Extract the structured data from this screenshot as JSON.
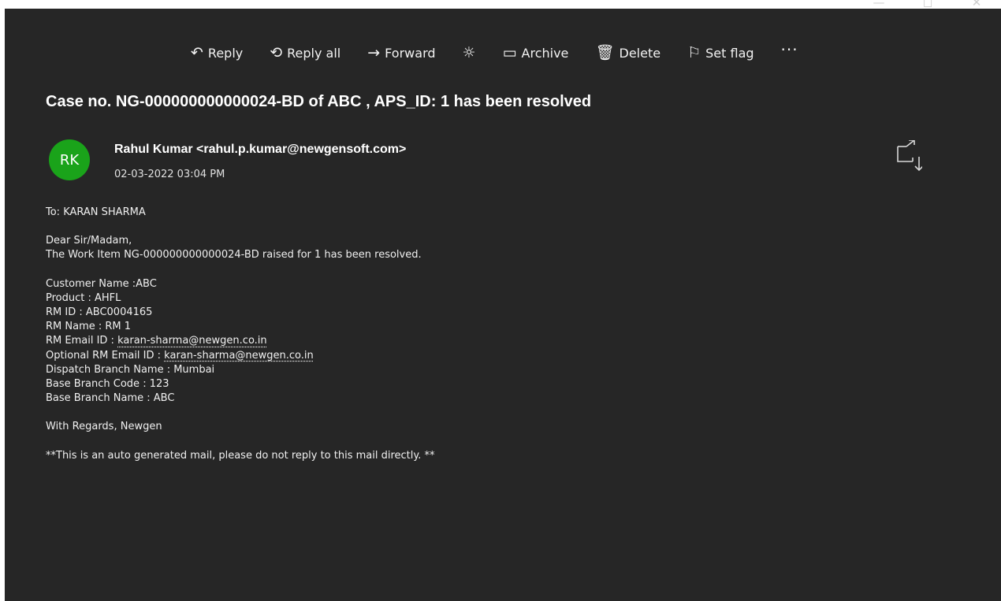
{
  "window": {
    "controls": {
      "minimize": "—",
      "restore": "◻",
      "close": "✕"
    }
  },
  "toolbar": {
    "reply": {
      "icon": "reply-icon",
      "glyph": "↶",
      "label": "Reply"
    },
    "reply_all": {
      "icon": "reply-all-icon",
      "glyph": "⟲",
      "label": "Reply all"
    },
    "forward": {
      "icon": "forward-icon",
      "glyph": "→",
      "label": "Forward"
    },
    "theme": {
      "icon": "sun-icon",
      "glyph": "☼"
    },
    "archive": {
      "icon": "archive-icon",
      "glyph": "▭",
      "label": "Archive"
    },
    "delete": {
      "icon": "trash-icon",
      "glyph": "🗑",
      "label": "Delete"
    },
    "set_flag": {
      "icon": "flag-icon",
      "glyph": "⚐",
      "label": "Set flag"
    },
    "more": {
      "icon": "more-icon",
      "glyph": "···"
    }
  },
  "message": {
    "subject": "Case no. NG-000000000000024-BD of  ABC , APS_ID:  1 has been resolved",
    "avatar_initials": "RK",
    "avatar_color": "#1aa31a",
    "sender": "Rahul  Kumar <rahul.p.kumar@newgensoft.com>",
    "date": "02-03-2022 03:04 PM",
    "to": "To: KARAN  SHARMA",
    "greeting": "Dear Sir/Madam,",
    "intro": "The Work Item NG-000000000000024-BD raised for 1 has been resolved.",
    "details": {
      "customer_name": "Customer Name :ABC",
      "product": "Product : AHFL",
      "rm_id": "RM ID : ABC0004165",
      "rm_name": "RM Name : RM 1",
      "rm_email_label": "RM Email ID : ",
      "rm_email": "karan-sharma@newgen.co.in",
      "opt_rm_email_label": "Optional RM Email ID : ",
      "opt_rm_email": "karan-sharma@newgen.co.in",
      "dispatch_branch": "Dispatch Branch Name : Mumbai",
      "base_branch_code": "Base Branch Code : 123",
      "base_branch_name": "Base Branch Name : ABC"
    },
    "regards": "With Regards, Newgen",
    "footer": "**This is an auto generated mail, please do not reply to this mail directly. **"
  },
  "colors": {
    "background": "#262626",
    "text": "#ffffff"
  }
}
